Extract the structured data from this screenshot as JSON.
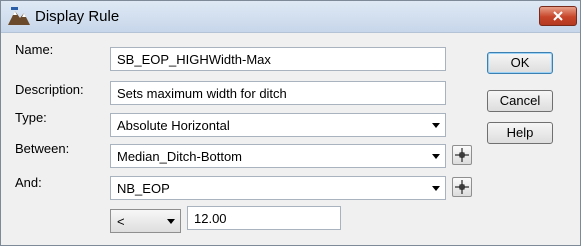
{
  "window": {
    "title": "Display Rule",
    "icon": "display-rule-app-icon",
    "close_icon": "close-icon"
  },
  "form": {
    "name_label": "Name:",
    "name_value": "SB_EOP_HIGHWidth-Max",
    "description_label": "Description:",
    "description_value": "Sets maximum width for ditch",
    "type_label": "Type:",
    "type_value": "Absolute Horizontal",
    "between_label": "Between:",
    "between_value": "Median_Ditch-Bottom",
    "and_label": "And:",
    "and_value": "NB_EOP",
    "operator_value": "<",
    "limit_value": "12.00"
  },
  "buttons": {
    "ok": "OK",
    "cancel": "Cancel",
    "help": "Help"
  },
  "colors": {
    "titlebar": "#c7d6ea",
    "close_button": "#c7452a",
    "default_button_border": "#3c7fb1"
  }
}
